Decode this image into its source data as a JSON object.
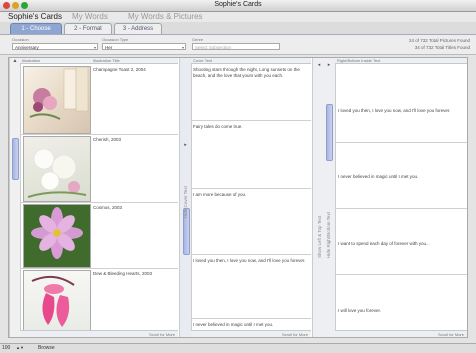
{
  "window": {
    "title": "Sophie's Cards"
  },
  "nav": {
    "active": "Sophie's Cards",
    "items": [
      "My Words",
      "My Words & Pictures"
    ]
  },
  "tabs": [
    "1 - Choose",
    "2 - Format",
    "3 - Address"
  ],
  "filters": {
    "occasion_label": "Occasion",
    "occasion_value": "Anniversary",
    "occasion_type_label": "Occasion Type",
    "occasion_type_value": "Her",
    "genre_label": "Genre",
    "genre_placeholder": "Select Subsection"
  },
  "counts": {
    "pictures_found": "24 of 732 Total Pictures Found",
    "titles_found": "34 of 732 Total Titles Found"
  },
  "columns": {
    "illustration": "Illustration",
    "illustration_title": "Illustration Title",
    "cover_text": "Cover Text",
    "inside_text": "Right/Bottom Inside Text",
    "scroll_for_more": "Scroll for More"
  },
  "illustrations": [
    {
      "title": "Champagne Toast 2, 2004",
      "image": "champagne-roses"
    },
    {
      "title": "Cherish, 2003",
      "image": "white-roses"
    },
    {
      "title": "Cosmos, 2003",
      "image": "pink-cosmos"
    },
    {
      "title": "Dew & Bleeding Hearts, 2003",
      "image": "bleeding-hearts"
    }
  ],
  "cover_texts": [
    "Shooting stars through the night, Long sunsets on the beach, and the love that yours with you each.",
    "Fairy tales do come true.",
    "I am more because of you.",
    "I loved you then, I love you now, and I'll love you forever.",
    "I never believed in magic until I met you."
  ],
  "inside_texts": [
    "I loved you then, I love you now, and I'll love you forever.",
    "I never believed in magic until I met you.",
    "I want to spend each day of forever with you...",
    "I will love you forever."
  ],
  "vertical_labels": {
    "hide_cover": "Hide Cover Text",
    "show_left_top": "Show Left & Top Text",
    "hide_right_bottom": "Hide Right/Bottom Text"
  },
  "status": {
    "zoom": "100",
    "mode": "Browse"
  }
}
